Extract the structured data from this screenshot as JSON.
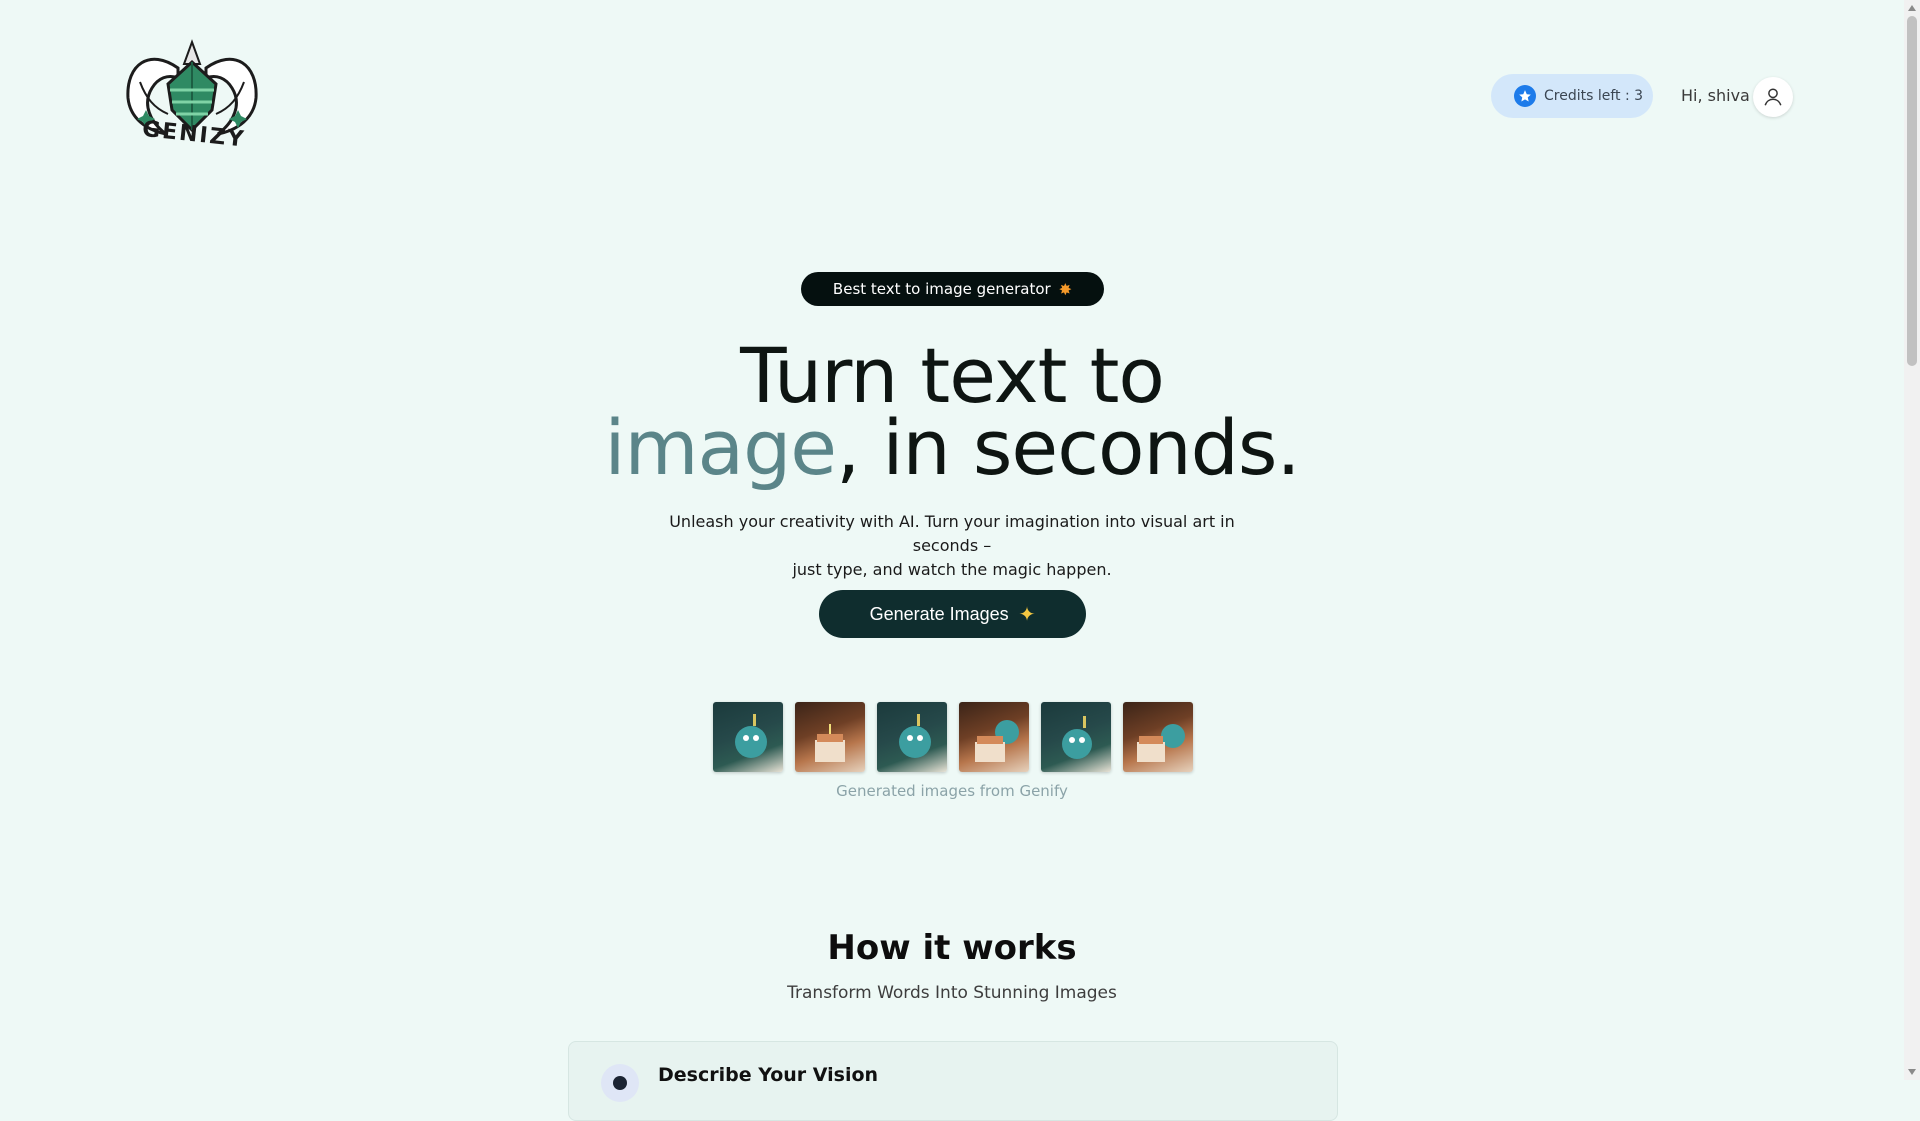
{
  "header": {
    "logo_text": "GENIZY",
    "credits_label": "Credits left : 3",
    "greeting": "Hi, shiva"
  },
  "hero": {
    "badge_text": "Best text to image generator",
    "title_line1": "Turn text to",
    "title_accent": "image",
    "title_rest": ", in seconds.",
    "subtitle_line1": "Unleash your creativity with AI. Turn your imagination into visual art in seconds –",
    "subtitle_line2": "just type, and watch the magic happen.",
    "cta_label": "Generate Images",
    "thumbnails_caption": "Generated images from Genify"
  },
  "how_it_works": {
    "title": "How it works",
    "subtitle": "Transform Words Into Stunning Images",
    "steps": [
      {
        "title": "Describe Your Vision"
      }
    ]
  },
  "colors": {
    "background": "#eef9f6",
    "accent_text": "#5b8589",
    "cta_background": "#0f2d2e",
    "credits_background": "#d3e7fa",
    "credits_icon": "#1d7bea"
  },
  "icons": {
    "credits": "star-icon",
    "avatar": "user-icon",
    "badge": "sparkle-icon",
    "cta": "sparkles-icon"
  }
}
